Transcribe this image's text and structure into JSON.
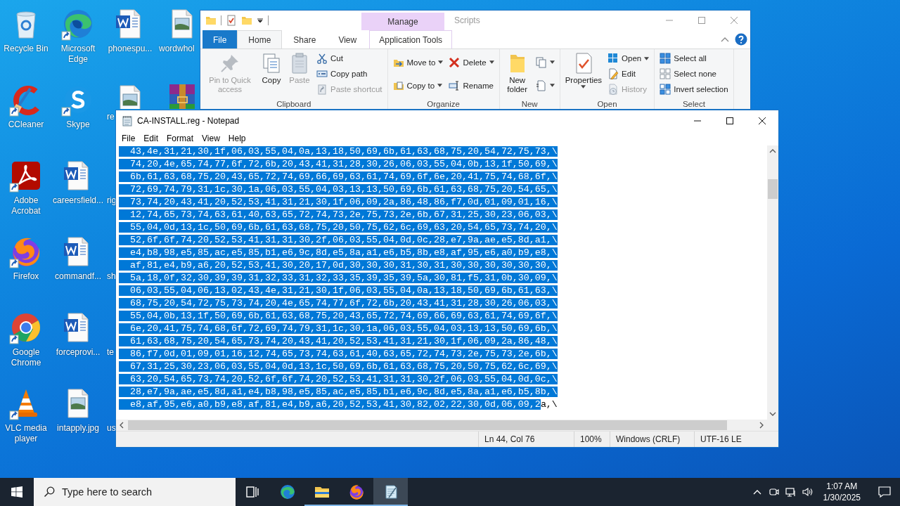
{
  "desktop": {
    "icons": [
      {
        "label": "Recycle Bin",
        "kind": "recycle",
        "shortcut": false
      },
      {
        "label": "CCleaner",
        "kind": "ccleaner",
        "shortcut": true
      },
      {
        "label": "Adobe Acrobat",
        "kind": "acrobat",
        "shortcut": true
      },
      {
        "label": "Firefox",
        "kind": "firefox",
        "shortcut": true
      },
      {
        "label": "Google Chrome",
        "kind": "chrome",
        "shortcut": true
      },
      {
        "label": "VLC media player",
        "kind": "vlc",
        "shortcut": true
      },
      {
        "label": "Microsoft Edge",
        "kind": "edge",
        "shortcut": true
      },
      {
        "label": "Skype",
        "kind": "skype",
        "shortcut": true
      },
      {
        "label": "careersfield...",
        "kind": "word",
        "shortcut": false
      },
      {
        "label": "commandf...",
        "kind": "word",
        "shortcut": false
      },
      {
        "label": "forceprovi...",
        "kind": "word",
        "shortcut": false
      },
      {
        "label": "intapply.jpg",
        "kind": "image",
        "shortcut": false
      },
      {
        "label": "phonespu...",
        "kind": "word",
        "shortcut": false
      },
      {
        "label": "re",
        "kind": "image",
        "shortcut": false,
        "clipped": true
      },
      {
        "label": "rig",
        "kind": "hidden",
        "clipped": true
      },
      {
        "label": "sh",
        "kind": "hidden",
        "clipped": true
      },
      {
        "label": "te",
        "kind": "hidden",
        "clipped": true
      },
      {
        "label": "us",
        "kind": "hidden",
        "clipped": true
      },
      {
        "label": "wordwhol",
        "kind": "image",
        "shortcut": false,
        "clipped": true
      },
      {
        "kind": "archive",
        "shortcut": false
      }
    ]
  },
  "explorer": {
    "title": "Scripts",
    "context_header": "Manage",
    "tabs": [
      {
        "label": "File",
        "kind": "file",
        "selected": false
      },
      {
        "label": "Home",
        "kind": "tab",
        "selected": true
      },
      {
        "label": "Share",
        "kind": "tab",
        "selected": false
      },
      {
        "label": "View",
        "kind": "tab",
        "selected": false
      },
      {
        "label": "Application Tools",
        "kind": "context",
        "selected": false
      }
    ],
    "groups": [
      {
        "label": "Clipboard",
        "columns": [
          [
            {
              "label": "Pin to Quick access",
              "disabled": true
            }
          ],
          [
            {
              "label": "Copy",
              "disabled": false
            }
          ],
          [
            {
              "label": "Paste",
              "disabled": true
            }
          ],
          [
            {
              "label": "Cut",
              "disabled": false
            },
            {
              "label": "Copy path",
              "disabled": false
            },
            {
              "label": "Paste shortcut",
              "disabled": true
            }
          ]
        ]
      },
      {
        "label": "Organize",
        "columns": [
          [
            {
              "label": "Move to",
              "disabled": false,
              "menu": true
            },
            {
              "label": "Copy to",
              "disabled": false,
              "menu": true
            }
          ],
          [
            {
              "label": "Delete",
              "disabled": false,
              "menu": true
            },
            {
              "label": "Rename",
              "disabled": false
            }
          ]
        ]
      },
      {
        "label": "New",
        "columns": [
          [
            {
              "label": "New folder",
              "disabled": false
            }
          ],
          [
            {
              "menu": true
            },
            {
              "menu": true
            }
          ]
        ]
      },
      {
        "label": "Open",
        "columns": [
          [
            {
              "label": "Properties",
              "disabled": false,
              "menu": true
            }
          ],
          [
            {
              "label": "Open",
              "disabled": false,
              "menu": true
            },
            {
              "label": "Edit",
              "disabled": false
            },
            {
              "label": "History",
              "disabled": true
            }
          ]
        ]
      },
      {
        "label": "Select",
        "columns": [
          [
            {
              "label": "Select all",
              "disabled": false
            },
            {
              "label": "Select none",
              "disabled": false
            },
            {
              "label": "Invert selection",
              "disabled": false
            }
          ]
        ]
      }
    ]
  },
  "notepad": {
    "title": "CA-INSTALL.reg - Notepad",
    "menu": [
      "File",
      "Edit",
      "Format",
      "View",
      "Help"
    ],
    "lines": [
      {
        "selected_text": "  43,4e,31,21,30,1f,06,03,55,04,0a,13,18,50,69,6b,61,63,68,75,20,54,72,75,73,\\"
      },
      {
        "selected_text": "  74,20,4e,65,74,77,6f,72,6b,20,43,41,31,28,30,26,06,03,55,04,0b,13,1f,50,69,\\"
      },
      {
        "selected_text": "  6b,61,63,68,75,20,43,65,72,74,69,66,69,63,61,74,69,6f,6e,20,41,75,74,68,6f,\\"
      },
      {
        "selected_text": "  72,69,74,79,31,1c,30,1a,06,03,55,04,03,13,13,50,69,6b,61,63,68,75,20,54,65,\\"
      },
      {
        "selected_text": "  73,74,20,43,41,20,52,53,41,31,21,30,1f,06,09,2a,86,48,86,f7,0d,01,09,01,16,\\"
      },
      {
        "selected_text": "  12,74,65,73,74,63,61,40,63,65,72,74,73,2e,75,73,2e,6b,67,31,25,30,23,06,03,\\"
      },
      {
        "selected_text": "  55,04,0d,13,1c,50,69,6b,61,63,68,75,20,50,75,62,6c,69,63,20,54,65,73,74,20,\\"
      },
      {
        "selected_text": "  52,6f,6f,74,20,52,53,41,31,31,30,2f,06,03,55,04,0d,0c,28,e7,9a,ae,e5,8d,a1,\\"
      },
      {
        "selected_text": "  e4,b8,98,e5,85,ac,e5,85,b1,e6,9c,8d,e5,8a,a1,e6,b5,8b,e8,af,95,e6,a0,b9,e8,\\"
      },
      {
        "selected_text": "  af,81,e4,b9,a6,20,52,53,41,30,20,17,0d,30,30,30,31,30,31,30,30,30,30,30,30,\\"
      },
      {
        "selected_text": "  5a,18,0f,32,30,39,39,31,32,33,31,32,33,35,39,35,39,5a,30,81,f5,31,0b,30,09,\\"
      },
      {
        "selected_text": "  06,03,55,04,06,13,02,43,4e,31,21,30,1f,06,03,55,04,0a,13,18,50,69,6b,61,63,\\"
      },
      {
        "selected_text": "  68,75,20,54,72,75,73,74,20,4e,65,74,77,6f,72,6b,20,43,41,31,28,30,26,06,03,\\"
      },
      {
        "selected_text": "  55,04,0b,13,1f,50,69,6b,61,63,68,75,20,43,65,72,74,69,66,69,63,61,74,69,6f,\\"
      },
      {
        "selected_text": "  6e,20,41,75,74,68,6f,72,69,74,79,31,1c,30,1a,06,03,55,04,03,13,13,50,69,6b,\\"
      },
      {
        "selected_text": "  61,63,68,75,20,54,65,73,74,20,43,41,20,52,53,41,31,21,30,1f,06,09,2a,86,48,\\"
      },
      {
        "selected_text": "  86,f7,0d,01,09,01,16,12,74,65,73,74,63,61,40,63,65,72,74,73,2e,75,73,2e,6b,\\"
      },
      {
        "selected_text": "  67,31,25,30,23,06,03,55,04,0d,13,1c,50,69,6b,61,63,68,75,20,50,75,62,6c,69,\\"
      },
      {
        "selected_text": "  63,20,54,65,73,74,20,52,6f,6f,74,20,52,53,41,31,31,30,2f,06,03,55,04,0d,0c,\\"
      },
      {
        "selected_text": "  28,e7,9a,ae,e5,8d,a1,e4,b8,98,e5,85,ac,e5,85,b1,e6,9c,8d,e5,8a,a1,e6,b5,8b,\\"
      },
      {
        "selected_text": "  e8,af,95,e6,a0,b9,e8,af,81,e4,b9,a6,20,52,53,41,30,82,02,22,30,0d,06,09,2",
        "text": "a,\\"
      }
    ],
    "status": [
      "Ln 44, Col 76",
      "100%",
      "Windows (CRLF)",
      "UTF-16 LE"
    ]
  },
  "taskbar": {
    "search": {
      "placeholder": "Type here to search"
    },
    "apps": [
      {
        "kind": "taskview",
        "running": false,
        "selected": false
      },
      {
        "kind": "edge",
        "running": false,
        "selected": false
      },
      {
        "kind": "explorer",
        "running": true,
        "selected": false
      },
      {
        "kind": "firefox",
        "running": true,
        "selected": false
      },
      {
        "kind": "notepad",
        "running": true,
        "selected": true
      }
    ],
    "time": "1:07 AM",
    "date": "1/30/2025"
  }
}
